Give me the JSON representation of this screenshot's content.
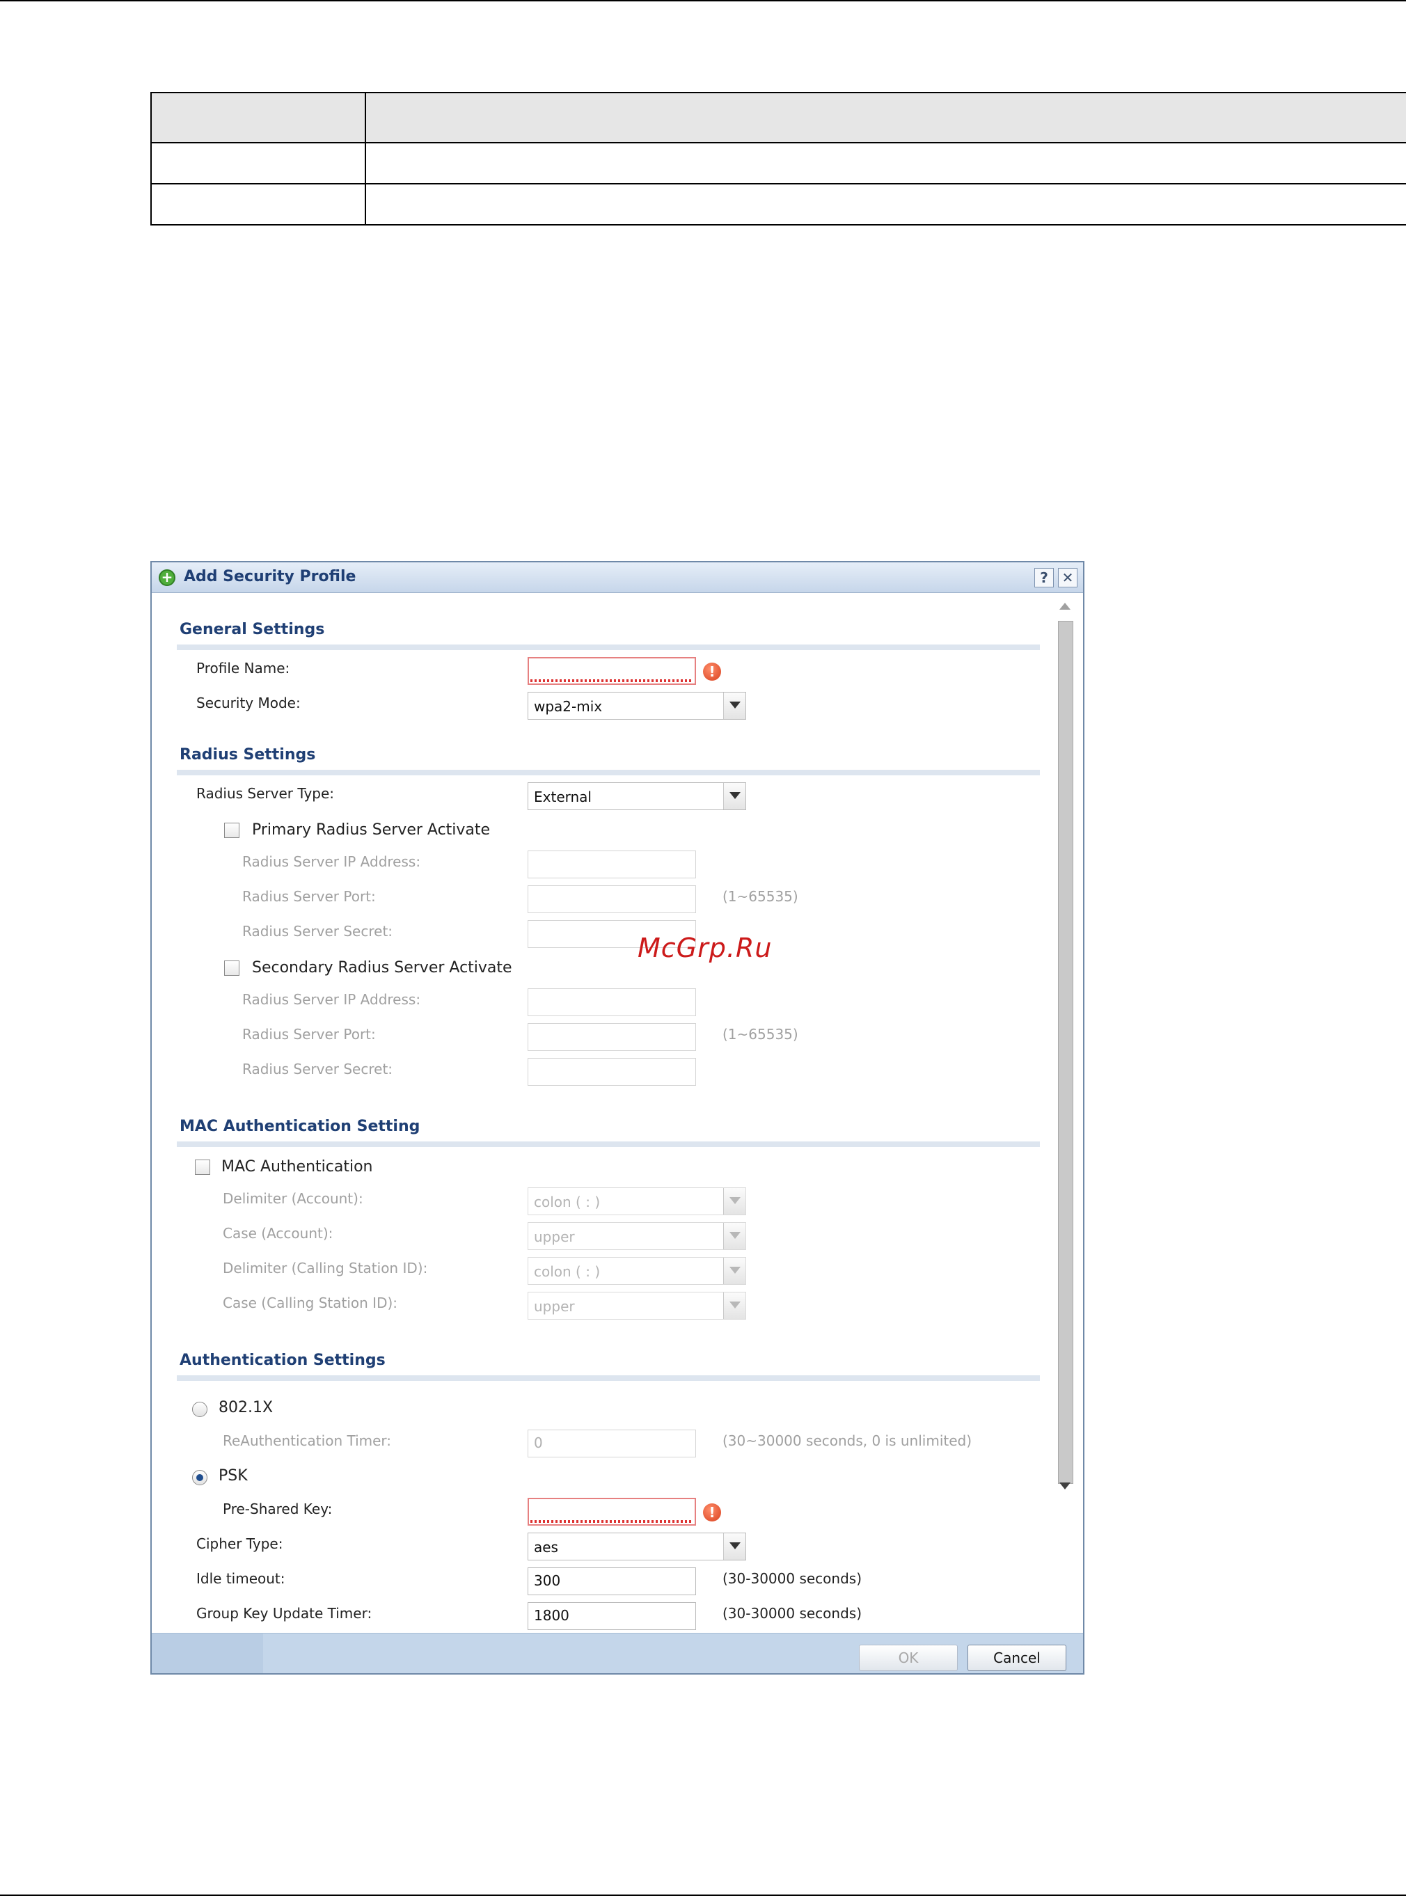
{
  "watermark": "McGrp.Ru",
  "dialog": {
    "title": "Add Security Profile",
    "help_label": "?",
    "close_label": "✕",
    "icons": {
      "title": "add-circle-icon",
      "error": "exclamation-icon"
    },
    "colors": {
      "header": "#1f3f74",
      "title_bar": "#c6d6ea",
      "error": "#d8401e"
    },
    "general": {
      "heading": "General Settings",
      "profile_name_label": "Profile Name:",
      "profile_name_value": "",
      "security_mode_label": "Security Mode:",
      "security_mode_value": "wpa2-mix"
    },
    "radius": {
      "heading": "Radius Settings",
      "server_type_label": "Radius Server Type:",
      "server_type_value": "External",
      "primary": {
        "activate_label": "Primary Radius Server Activate",
        "checked": false,
        "ip_label": "Radius Server IP Address:",
        "port_label": "Radius Server Port:",
        "port_hint": "(1~65535)",
        "secret_label": "Radius Server Secret:"
      },
      "secondary": {
        "activate_label": "Secondary Radius Server Activate",
        "checked": false,
        "ip_label": "Radius Server IP Address:",
        "port_label": "Radius Server Port:",
        "port_hint": "(1~65535)",
        "secret_label": "Radius Server Secret:"
      }
    },
    "mac": {
      "heading": "MAC Authentication Setting",
      "activate_label": "MAC Authentication",
      "checked": false,
      "delimiter_account_label": "Delimiter (Account):",
      "delimiter_account_value": "colon ( : )",
      "case_account_label": "Case (Account):",
      "case_account_value": "upper",
      "delimiter_station_label": "Delimiter (Calling Station ID):",
      "delimiter_station_value": "colon ( : )",
      "case_station_label": "Case (Calling Station ID):",
      "case_station_value": "upper"
    },
    "auth": {
      "heading": "Authentication Settings",
      "dot1x_label": "802.1X",
      "reauth_label": "ReAuthentication Timer:",
      "reauth_value": "0",
      "reauth_hint": "(30~30000 seconds, 0 is unlimited)",
      "psk_label": "PSK",
      "psk_selected": true,
      "preshared_label": "Pre-Shared Key:",
      "preshared_value": "",
      "cipher_label": "Cipher Type:",
      "cipher_value": "aes",
      "idle_label": "Idle timeout:",
      "idle_value": "300",
      "idle_hint": "(30-30000 seconds)",
      "group_key_label": "Group Key Update Timer:",
      "group_key_value": "1800",
      "group_key_hint": "(30-30000 seconds)"
    },
    "buttons": {
      "ok": "OK",
      "cancel": "Cancel"
    }
  }
}
